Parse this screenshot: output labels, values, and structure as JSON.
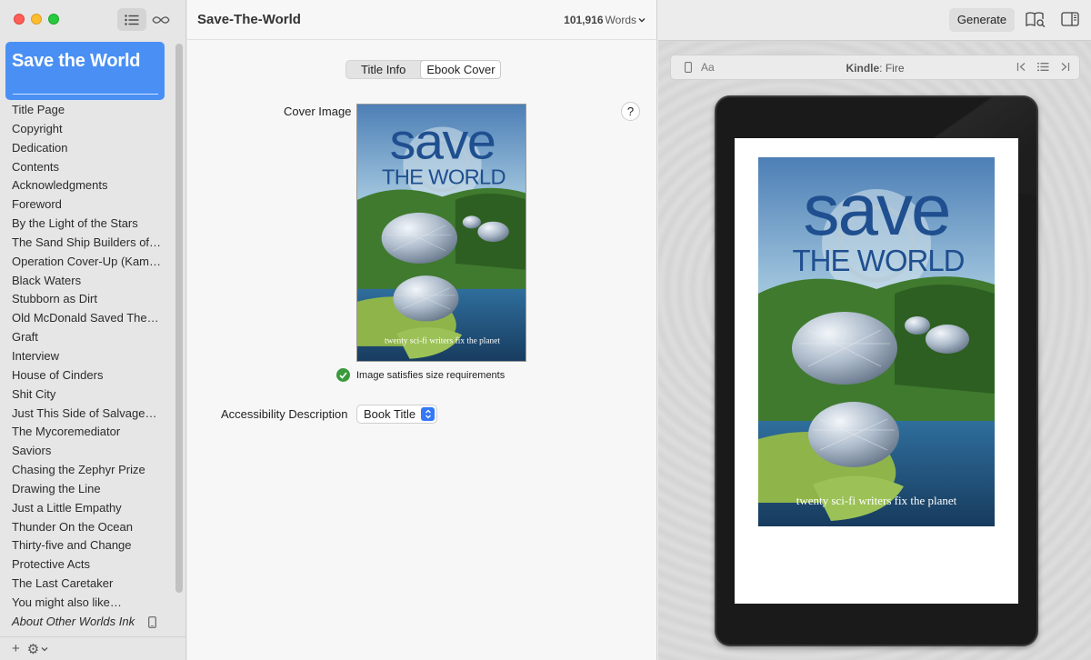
{
  "sidebar": {
    "book_title": "Save the World",
    "chapters": [
      "Title Page",
      "Copyright",
      "Dedication",
      "Contents",
      "Acknowledgments",
      "Foreword",
      "By the Light of the Stars",
      "The Sand Ship Builders of…",
      "Operation Cover-Up (Kam…",
      "Black Waters",
      "Stubborn as Dirt",
      "Old McDonald Saved The…",
      "Graft",
      "Interview",
      "House of Cinders",
      "Shit City",
      "Just This Side of Salvage…",
      "The Mycoremediator",
      "Saviors",
      "Chasing the Zephyr Prize",
      "Drawing the Line",
      "Just a Little Empathy",
      "Thunder On the Ocean",
      "Thirty-five and Change",
      "Protective Acts",
      "The Last Caretaker",
      "You might also like…"
    ],
    "last_chapter": "About Other Worlds Ink",
    "bottom": {
      "add": "+",
      "gear": "⚙"
    }
  },
  "center": {
    "doc_title": "Save-The-World",
    "word_count": "101,916",
    "word_unit": "Words",
    "tabs": [
      "Title Info",
      "Ebook Cover"
    ],
    "cover_label": "Cover Image",
    "help": "?",
    "size_status": "Image satisfies size requirements",
    "accessibility_label": "Accessibility Description",
    "accessibility_value": "Book Title"
  },
  "cover": {
    "title_top": "save",
    "title_bottom": "THE WORLD",
    "tagline": "twenty sci-fi writers fix the planet"
  },
  "preview": {
    "generate": "Generate",
    "font_button": "Aa",
    "device_brand": "Kindle",
    "device_model": ": Fire"
  },
  "colors": {
    "accent": "#4a90f4",
    "check": "#3a9a3c",
    "cover_title": "#1f4f8f"
  }
}
